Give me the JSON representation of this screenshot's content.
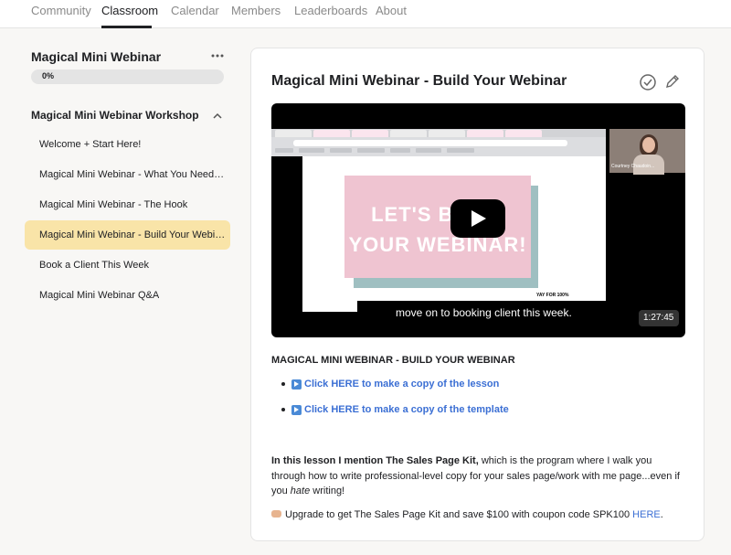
{
  "nav": {
    "tabs": [
      "Community",
      "Classroom",
      "Calendar",
      "Members",
      "Leaderboards",
      "About"
    ],
    "active_tab": "Classroom"
  },
  "sidebar": {
    "course_title": "Magical Mini Webinar",
    "progress_label": "0%",
    "progress_value": 0,
    "module_title": "Magical Mini Webinar Workshop",
    "lessons": [
      "Welcome + Start Here!",
      "Magical Mini Webinar - What You Need to Know",
      "Magical Mini Webinar - The Hook",
      "Magical Mini Webinar - Build Your Webinar",
      "Book a Client This Week",
      "Magical Mini Webinar Q&A"
    ],
    "active_lesson_index": 3
  },
  "lesson": {
    "title": "Magical Mini Webinar - Build Your Webinar",
    "video": {
      "slide_text": "LET'S BUILD\nYOUR WEBINAR!",
      "caption": "move on to booking client this week.",
      "duration": "1:27:45",
      "presenter_name": "Courtney Chaudoin...",
      "slide_footer": "YAY FOR 100%"
    },
    "section_title": "MAGICAL MINI WEBINAR - BUILD YOUR WEBINAR",
    "links": [
      "Click HERE to make a copy of the lesson",
      "Click HERE to make a copy of the template"
    ],
    "paragraph_bold": "In this lesson I mention The Sales Page Kit,",
    "paragraph_rest_1": " which is the program where I walk you through how to write professional-level copy for your sales page/work with me page...even if you ",
    "paragraph_italic": "hate",
    "paragraph_rest_2": " writing!",
    "upgrade_text": "Upgrade to get The Sales Page Kit and save $100 with coupon code SPK100 ",
    "upgrade_link": "HERE",
    "upgrade_end": "."
  },
  "colors": {
    "active_lesson_bg": "#f9e4a8",
    "link": "#3b6fd4",
    "slide_pink": "#efc4d1"
  }
}
